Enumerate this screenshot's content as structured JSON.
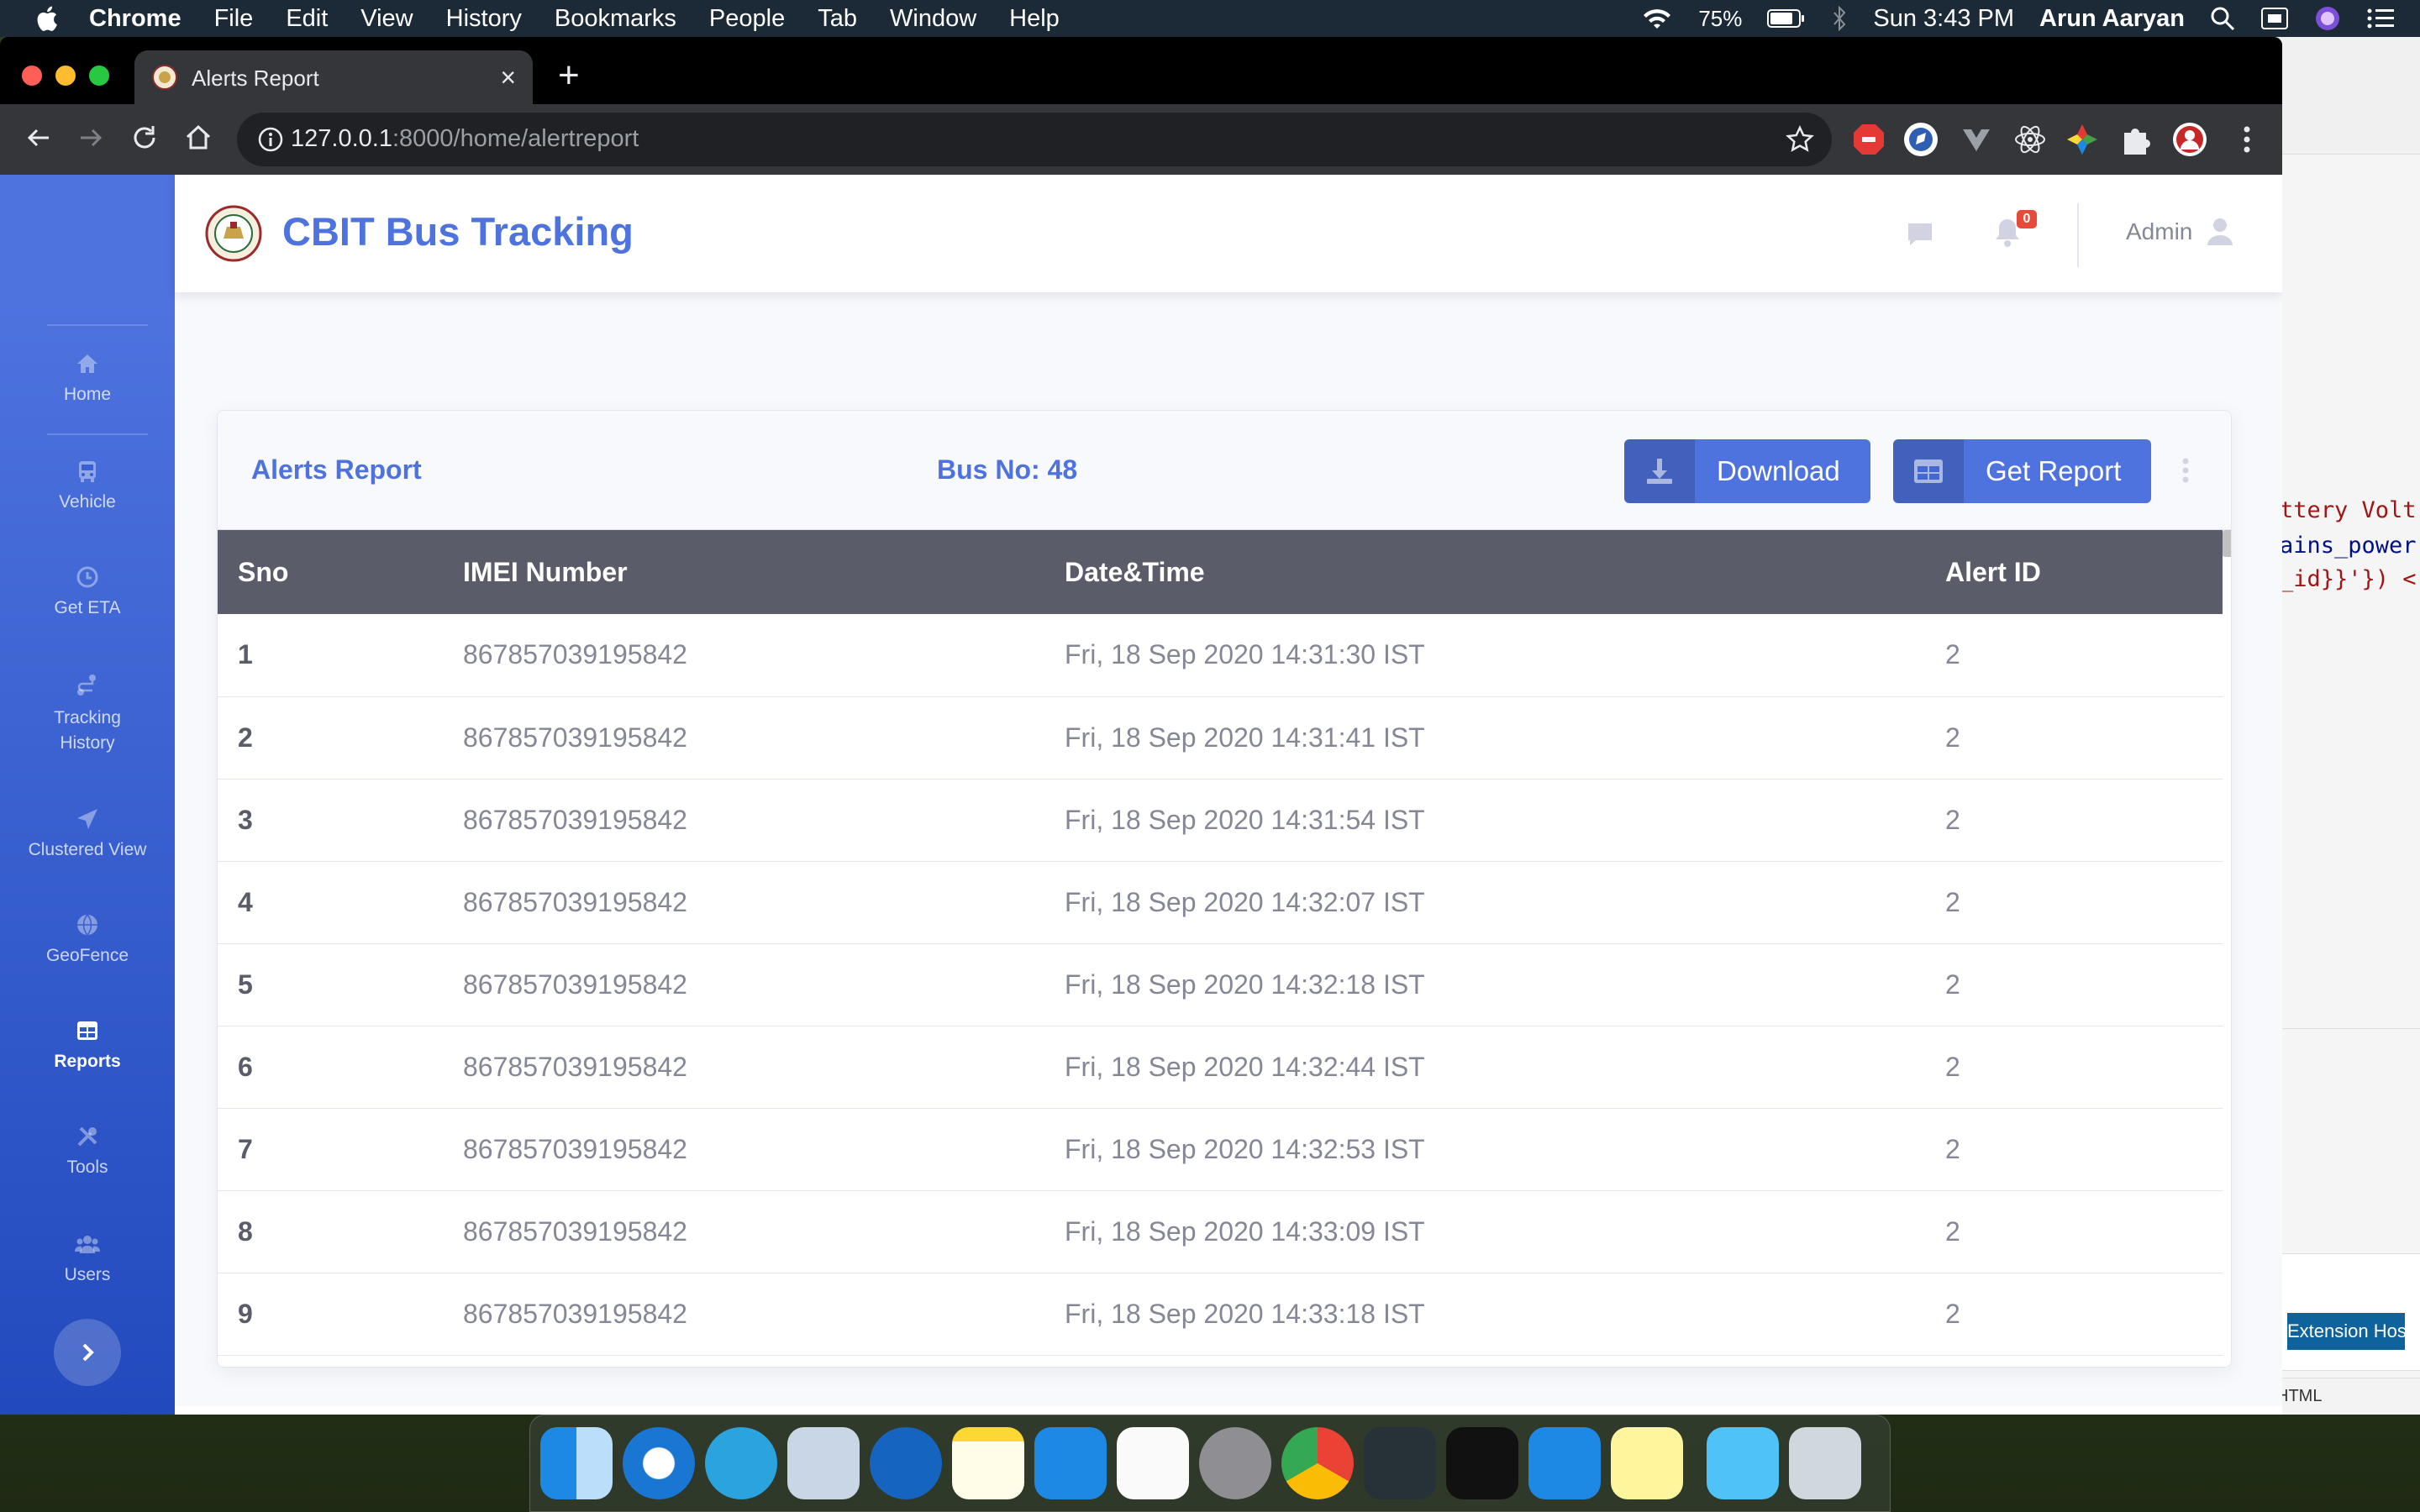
{
  "menubar": {
    "app": "Chrome",
    "items": [
      "File",
      "Edit",
      "View",
      "History",
      "Bookmarks",
      "People",
      "Tab",
      "Window",
      "Help"
    ],
    "battery": "75%",
    "clock": "Sun 3:43 PM",
    "user": "Arun Aaryan"
  },
  "editor": {
    "code_lines": [
      "ttery Volt",
      "ains_power",
      "_id}}'}) <"
    ],
    "toast_button": "Extension Host",
    "status_text": "HTML"
  },
  "browser": {
    "tab_title": "Alerts Report",
    "url_host": "127.0.0.1",
    "url_rest": ":8000/home/alertreport"
  },
  "sidebar": {
    "items": [
      {
        "label": "Home",
        "icon": "home-icon"
      },
      {
        "label": "Vehicle",
        "icon": "bus-icon"
      },
      {
        "label": "Get ETA",
        "icon": "clock-icon"
      },
      {
        "label": "Tracking History",
        "icon": "route-icon"
      },
      {
        "label": "Clustered View",
        "icon": "send-icon"
      },
      {
        "label": "GeoFence",
        "icon": "globe-icon"
      },
      {
        "label": "Reports",
        "icon": "table-icon",
        "active": true
      },
      {
        "label": "Tools",
        "icon": "tools-icon"
      },
      {
        "label": "Users",
        "icon": "users-icon"
      }
    ]
  },
  "topbar": {
    "brand": "CBIT Bus Tracking",
    "alerts_count": "0",
    "user_name": "Admin"
  },
  "card": {
    "title": "Alerts Report",
    "bus_no": "Bus No: 48",
    "download_label": "Download",
    "get_report_label": "Get Report"
  },
  "table": {
    "columns": [
      "Sno",
      "IMEI Number",
      "Date&Time",
      "Alert ID"
    ],
    "rows": [
      [
        "1",
        "867857039195842",
        "Fri, 18 Sep 2020 14:31:30 IST",
        "2"
      ],
      [
        "2",
        "867857039195842",
        "Fri, 18 Sep 2020 14:31:41 IST",
        "2"
      ],
      [
        "3",
        "867857039195842",
        "Fri, 18 Sep 2020 14:31:54 IST",
        "2"
      ],
      [
        "4",
        "867857039195842",
        "Fri, 18 Sep 2020 14:32:07 IST",
        "2"
      ],
      [
        "5",
        "867857039195842",
        "Fri, 18 Sep 2020 14:32:18 IST",
        "2"
      ],
      [
        "6",
        "867857039195842",
        "Fri, 18 Sep 2020 14:32:44 IST",
        "2"
      ],
      [
        "7",
        "867857039195842",
        "Fri, 18 Sep 2020 14:32:53 IST",
        "2"
      ],
      [
        "8",
        "867857039195842",
        "Fri, 18 Sep 2020 14:33:09 IST",
        "2"
      ],
      [
        "9",
        "867857039195842",
        "Fri, 18 Sep 2020 14:33:18 IST",
        "2"
      ]
    ]
  },
  "colors": {
    "primary": "#4e73df",
    "table_header": "#5a5c69",
    "text_muted": "#858796",
    "badge": "#e74a3b"
  }
}
